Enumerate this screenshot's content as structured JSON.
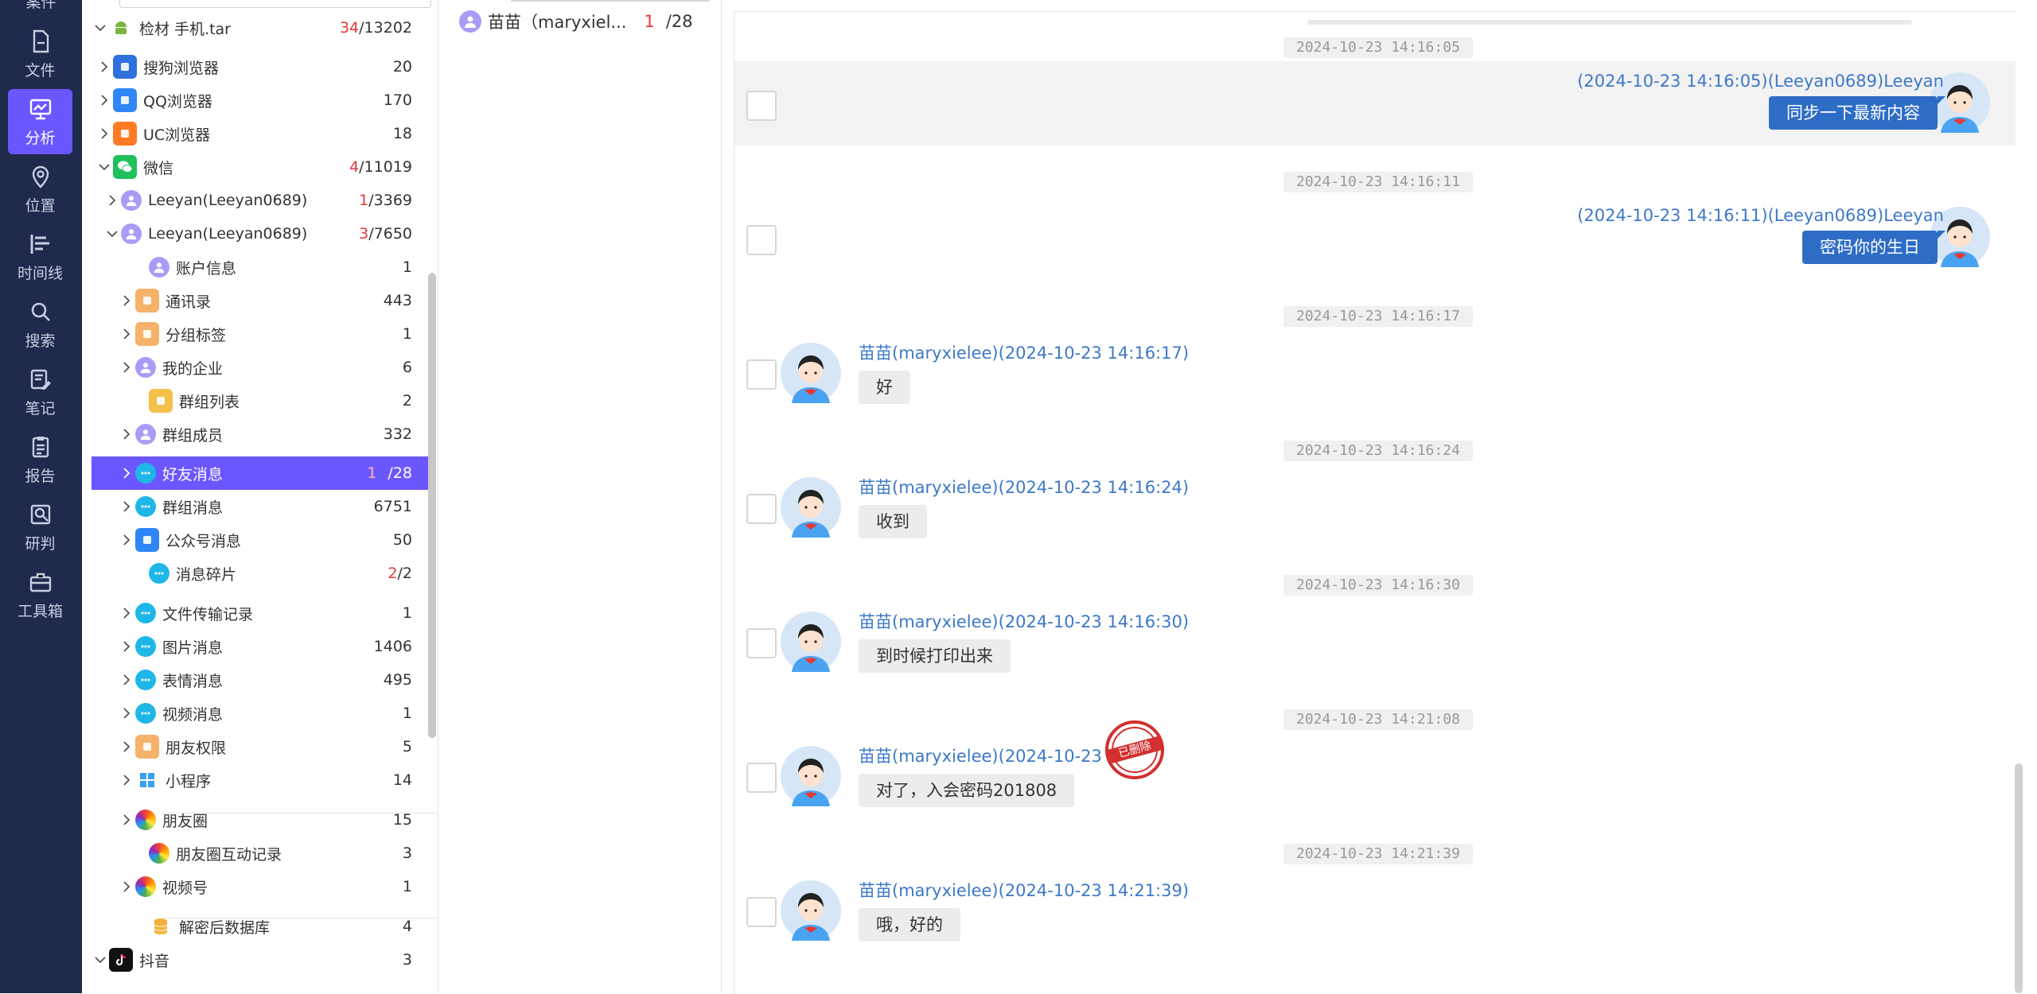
{
  "rail": {
    "top_label": "案件",
    "items": [
      {
        "label": "文件",
        "icon": "file-icon"
      },
      {
        "label": "分析",
        "icon": "analysis-icon",
        "active": true
      },
      {
        "label": "位置",
        "icon": "location-icon"
      },
      {
        "label": "时间线",
        "icon": "timeline-icon"
      },
      {
        "label": "搜索",
        "icon": "search-icon"
      },
      {
        "label": "笔记",
        "icon": "notes-icon"
      },
      {
        "label": "报告",
        "icon": "report-icon"
      },
      {
        "label": "研判",
        "icon": "judgment-icon"
      },
      {
        "label": "工具箱",
        "icon": "toolbox-icon"
      }
    ]
  },
  "tree": {
    "items": [
      {
        "label": "检材 手机.tar",
        "count_red": "34",
        "count_rest": "/13202",
        "icon": "android-icon"
      },
      {
        "label": "搜狗浏览器",
        "count_red": "",
        "count_rest": "20",
        "icon": "sogou-browser-icon"
      },
      {
        "label": "QQ浏览器",
        "count_red": "",
        "count_rest": "170",
        "icon": "qq-browser-icon"
      },
      {
        "label": "UC浏览器",
        "count_red": "",
        "count_rest": "18",
        "icon": "uc-browser-icon"
      },
      {
        "label": "微信",
        "count_red": "4",
        "count_rest": "/11019",
        "icon": "wechat-icon"
      },
      {
        "label": "Leeyan(Leeyan0689)",
        "count_red": "1",
        "count_rest": "/3369",
        "icon": "user-lock-icon"
      },
      {
        "label": "Leeyan(Leeyan0689)",
        "count_red": "3",
        "count_rest": "/7650",
        "icon": "user-lock-icon"
      },
      {
        "label": "账户信息",
        "count_red": "",
        "count_rest": "1",
        "icon": "account-icon"
      },
      {
        "label": "通讯录",
        "count_red": "",
        "count_rest": "443",
        "icon": "contacts-icon"
      },
      {
        "label": "分组标签",
        "count_red": "",
        "count_rest": "1",
        "icon": "group-tag-icon"
      },
      {
        "label": "我的企业",
        "count_red": "",
        "count_rest": "6",
        "icon": "enterprise-icon"
      },
      {
        "label": "群组列表",
        "count_red": "",
        "count_rest": "2",
        "icon": "group-list-icon"
      },
      {
        "label": "群组成员",
        "count_red": "",
        "count_rest": "332",
        "icon": "group-member-icon"
      },
      {
        "label": "好友消息",
        "count_red": "1",
        "count_rest": "/28",
        "icon": "chat-bubble-icon",
        "selected": true
      },
      {
        "label": "群组消息",
        "count_red": "",
        "count_rest": "6751",
        "icon": "chat-bubble-icon"
      },
      {
        "label": "公众号消息",
        "count_red": "",
        "count_rest": "50",
        "icon": "official-account-icon"
      },
      {
        "label": "消息碎片",
        "count_red": "2",
        "count_rest": "/2",
        "icon": "chat-bubble-icon"
      },
      {
        "label": "文件传输记录",
        "count_red": "",
        "count_rest": "1",
        "icon": "chat-bubble-icon"
      },
      {
        "label": "图片消息",
        "count_red": "",
        "count_rest": "1406",
        "icon": "chat-bubble-icon"
      },
      {
        "label": "表情消息",
        "count_red": "",
        "count_rest": "495",
        "icon": "chat-bubble-icon"
      },
      {
        "label": "视频消息",
        "count_red": "",
        "count_rest": "1",
        "icon": "chat-bubble-icon"
      },
      {
        "label": "朋友权限",
        "count_red": "",
        "count_rest": "5",
        "icon": "contacts-icon"
      },
      {
        "label": "小程序",
        "count_red": "",
        "count_rest": "14",
        "icon": "mini-program-icon"
      },
      {
        "label": "朋友圈",
        "count_red": "",
        "count_rest": "15",
        "icon": "moments-icon"
      },
      {
        "label": "朋友圈互动记录",
        "count_red": "",
        "count_rest": "3",
        "icon": "moments-icon"
      },
      {
        "label": "视频号",
        "count_red": "",
        "count_rest": "1",
        "icon": "moments-icon"
      },
      {
        "label": "解密后数据库",
        "count_red": "",
        "count_rest": "4",
        "icon": "database-icon"
      },
      {
        "label": "抖音",
        "count_red": "",
        "count_rest": "3",
        "icon": "douyin-icon"
      }
    ]
  },
  "contacts": {
    "name": "苗苗（maryxiel...",
    "count_red": "1",
    "count_rest": "/28"
  },
  "chat": {
    "messages": [
      {
        "time": "2024-10-23 14:16:05",
        "direction": "out",
        "sender": "(2024-10-23 14:16:05)(Leeyan0689)Leeyan",
        "text": "同步一下最新内容",
        "highlighted": true
      },
      {
        "time": "2024-10-23 14:16:11",
        "direction": "out",
        "sender": "(2024-10-23 14:16:11)(Leeyan0689)Leeyan",
        "text": "密码你的生日"
      },
      {
        "time": "2024-10-23 14:16:17",
        "direction": "in",
        "sender": "苗苗(maryxielee)(2024-10-23 14:16:17)",
        "text": "好"
      },
      {
        "time": "2024-10-23 14:16:24",
        "direction": "in",
        "sender": "苗苗(maryxielee)(2024-10-23 14:16:24)",
        "text": "收到"
      },
      {
        "time": "2024-10-23 14:16:30",
        "direction": "in",
        "sender": "苗苗(maryxielee)(2024-10-23 14:16:30)",
        "text": "到时候打印出来"
      },
      {
        "time": "2024-10-23 14:21:08",
        "direction": "in",
        "sender": "苗苗(maryxielee)(2024-10-23 14:2",
        "text": "对了，入会密码201808",
        "stamp": "已删除"
      },
      {
        "time": "2024-10-23 14:21:39",
        "direction": "in",
        "sender": "苗苗(maryxielee)(2024-10-23 14:21:39)",
        "text": "哦，好的"
      }
    ]
  },
  "colors": {
    "rail_bg": "#1f2a4d",
    "accent": "#6a57ff",
    "link_blue": "#3d78c8",
    "out_bubble": "#2e6dc6",
    "in_bubble": "#ececec",
    "count_red": "#e53935"
  }
}
